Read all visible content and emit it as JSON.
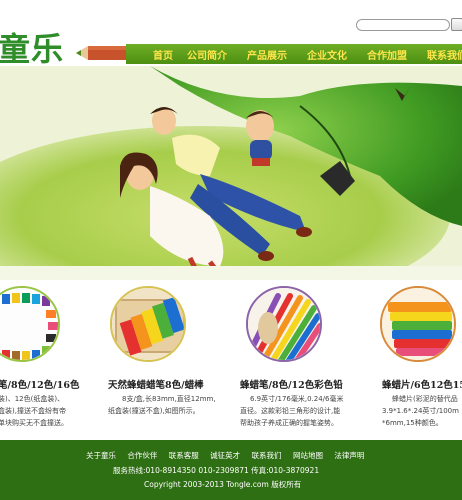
{
  "header": {
    "logo": "童乐",
    "search": {
      "placeholder": ""
    },
    "nav": [
      "首页",
      "公司简介",
      "产品展示",
      "企业文化",
      "合作加盟",
      "联系我们"
    ]
  },
  "products": [
    {
      "title": "笔/8色/12色/16色",
      "desc": [
        "装)、12色(纸盒装)、",
        "盒装),撞送不盒纷有帝",
        "单块购买无不盒撞送。"
      ]
    },
    {
      "title": "天然蜂蜡蜡笔8色/蜡棒",
      "desc": [
        "8支/盒,长83mm,直径12mm,",
        "纸盒装(撞送不盒),如图所示。"
      ]
    },
    {
      "title": "蜂蜡笔/8色/12色彩色铅",
      "desc": [
        "6.9英寸/176毫米,0.24/6毫米",
        "直径。这款彩铅三角形的设计,能",
        "帮助孩子养成正确的握笔姿势。"
      ]
    },
    {
      "title": "蜂蜡片/6色12色15",
      "desc": [
        "蜂蜡片(彩泥的替代品",
        "3.9*1.6*.24英寸/100m",
        "*6mm,15种颜色。"
      ]
    }
  ],
  "footer": {
    "links": [
      "关于童乐",
      "合作伙伴",
      "联系客服",
      "诚征英才",
      "联系我们",
      "网站地图",
      "法律声明"
    ],
    "hotline": "服务热线:010-8914350    010-2309871    传真:010-3870921",
    "copyright": "Copyright 2003-2013  Tongle.com 版权所有"
  }
}
